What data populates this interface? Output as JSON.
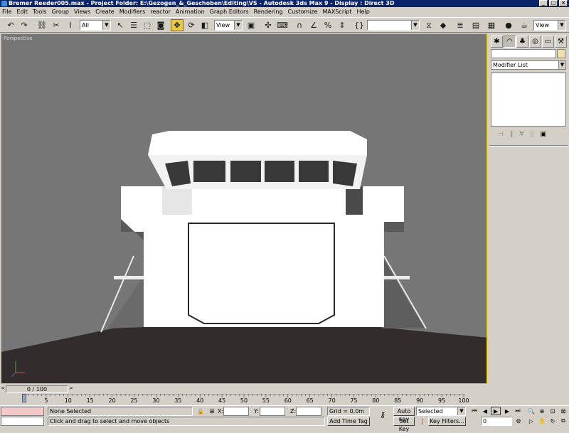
{
  "window": {
    "title": "Bremer Reeder005.max   - Project Folder: E:\\Gezogen_&_Geschoben\\Editing\\VS      - Autodesk 3ds Max 9      - Display : Direct 3D",
    "minimize": "_",
    "maximize": "□",
    "close": "×"
  },
  "menu": [
    "File",
    "Edit",
    "Tools",
    "Group",
    "Views",
    "Create",
    "Modifiers",
    "reactor",
    "Animation",
    "Graph Editors",
    "Rendering",
    "Customize",
    "MAXScript",
    "Help"
  ],
  "toolbar": {
    "selection_filter": "All",
    "reference_coord": "View",
    "named_selection": "",
    "view_combo_right": "View",
    "icons": [
      "undo-icon",
      "redo-icon",
      "select-link-icon",
      "unlink-icon",
      "bind-spacewarp-icon",
      "select-object-icon",
      "select-by-name-icon",
      "rect-region-icon",
      "window-crossing-icon",
      "select-move-icon",
      "select-rotate-icon",
      "select-scale-icon",
      "pivot-icon",
      "manipulate-icon",
      "keyboard-shortcut-icon",
      "snaps-icon",
      "angle-snap-icon",
      "percent-snap-icon",
      "spinner-snap-icon",
      "edit-named-sel-icon",
      "mirror-icon",
      "align-icon",
      "layer-manager-icon",
      "curve-editor-icon",
      "schematic-icon",
      "material-editor-icon",
      "render-scene-icon",
      "quick-render-icon"
    ]
  },
  "viewport": {
    "label": "Perspective",
    "colors": {
      "background": "#767676",
      "ground": "#332c2c",
      "hull": "#ffffff",
      "window": "#383838",
      "border": "#e7c300"
    }
  },
  "command_panel": {
    "tabs": [
      "create-tab-icon",
      "modify-tab-icon",
      "hierarchy-tab-icon",
      "motion-tab-icon",
      "display-tab-icon",
      "utilities-tab-icon"
    ],
    "object_name": "",
    "modifier_list": "Modifier List"
  },
  "timeline": {
    "frame_display": "0 / 100",
    "ticks": [
      "0",
      "5",
      "10",
      "15",
      "20",
      "25",
      "30",
      "35",
      "40",
      "45",
      "50",
      "55",
      "60",
      "65",
      "70",
      "75",
      "80",
      "85",
      "90",
      "95",
      "100"
    ]
  },
  "status": {
    "selection": "None Selected",
    "prompt": "Click and drag to select and move objects",
    "x_label": "X:",
    "y_label": "Y:",
    "z_label": "Z:",
    "x_value": "",
    "y_value": "",
    "z_value": "",
    "grid": "Grid = 0,0m",
    "add_time_tag": "Add Time Tag",
    "auto_key": "Auto Key",
    "set_key": "Set Key",
    "key_mode": "Selected",
    "key_filters": "Key Filters...",
    "current_frame": "0"
  }
}
